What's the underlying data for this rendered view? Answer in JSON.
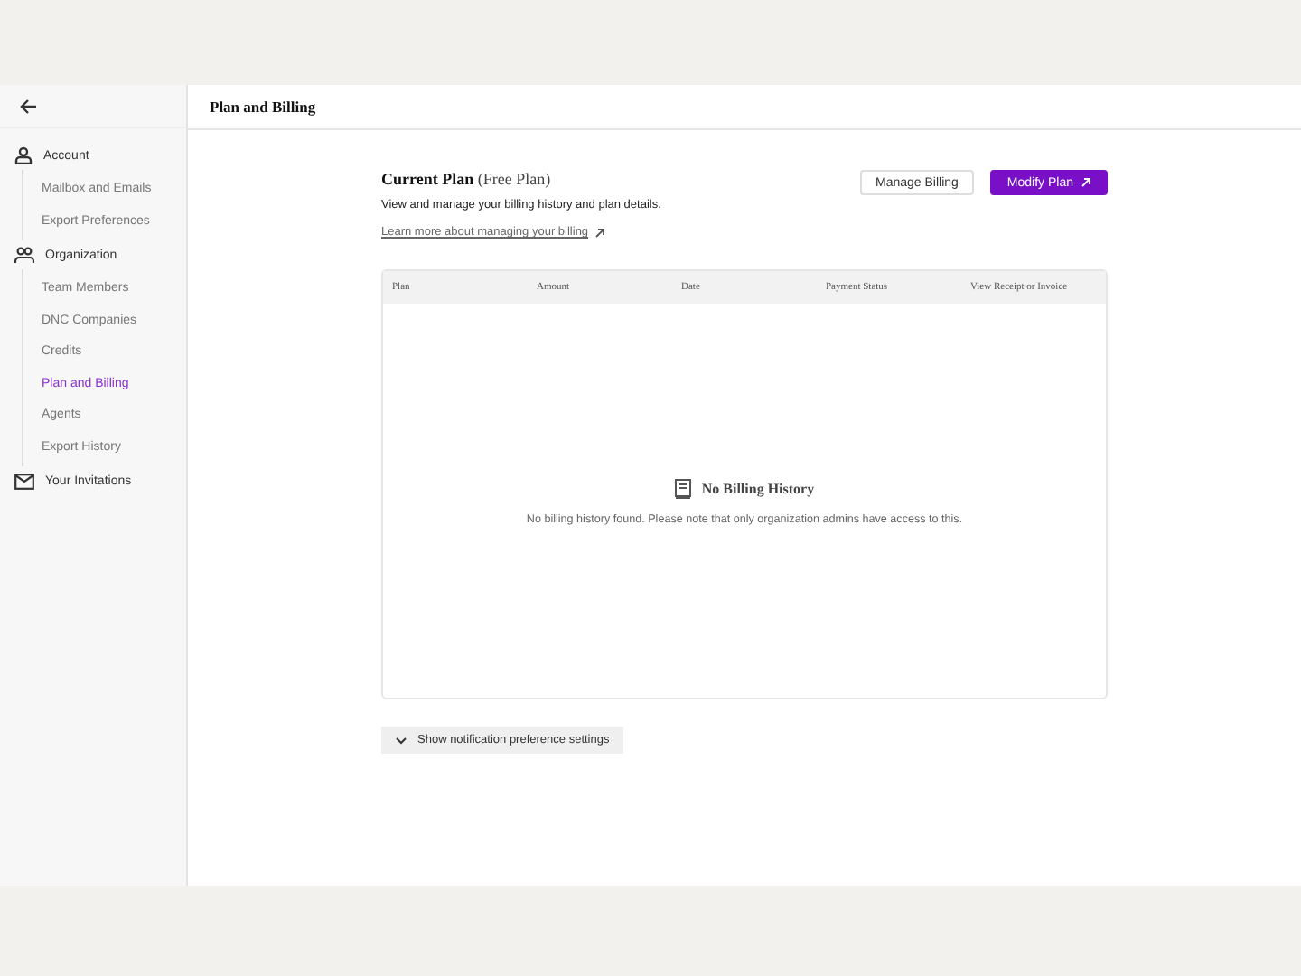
{
  "header": {
    "title": "Plan and Billing"
  },
  "sidebar": {
    "sections": [
      {
        "label": "Account",
        "kind": "person",
        "selected": false,
        "children": [
          {
            "label": "Mailbox and Emails",
            "selected": false
          },
          {
            "label": "Export Preferences",
            "selected": false
          }
        ]
      },
      {
        "label": "Organization",
        "kind": "people",
        "selected": false,
        "children": [
          {
            "label": "Team Members",
            "selected": false
          },
          {
            "label": "DNC Companies",
            "selected": false
          },
          {
            "label": "Credits",
            "selected": false
          },
          {
            "label": "Plan and Billing",
            "selected": true
          },
          {
            "label": "Agents",
            "selected": false
          },
          {
            "label": "Export History",
            "selected": false
          }
        ]
      },
      {
        "label": "Your Invitations",
        "kind": "mail",
        "selected": false
      }
    ]
  },
  "plan": {
    "title": "Current Plan",
    "plan_name": "(Free Plan)",
    "description": "View and manage your billing history and plan details.",
    "learn_link": "Learn more about managing your billing",
    "buttons": [
      {
        "label": "Manage Billing",
        "kind": "secondary"
      },
      {
        "label": "Modify Plan",
        "kind": "primary"
      }
    ]
  },
  "table": {
    "columns": [
      "Plan",
      "Amount",
      "Date",
      "Payment Status",
      "View Receipt or Invoice"
    ],
    "empty_title": "No Billing History",
    "empty_message": "No billing history found. Please note that only organization admins have access to this."
  },
  "notification_toggle": {
    "label": "Show notification preference settings",
    "expanded": false
  }
}
